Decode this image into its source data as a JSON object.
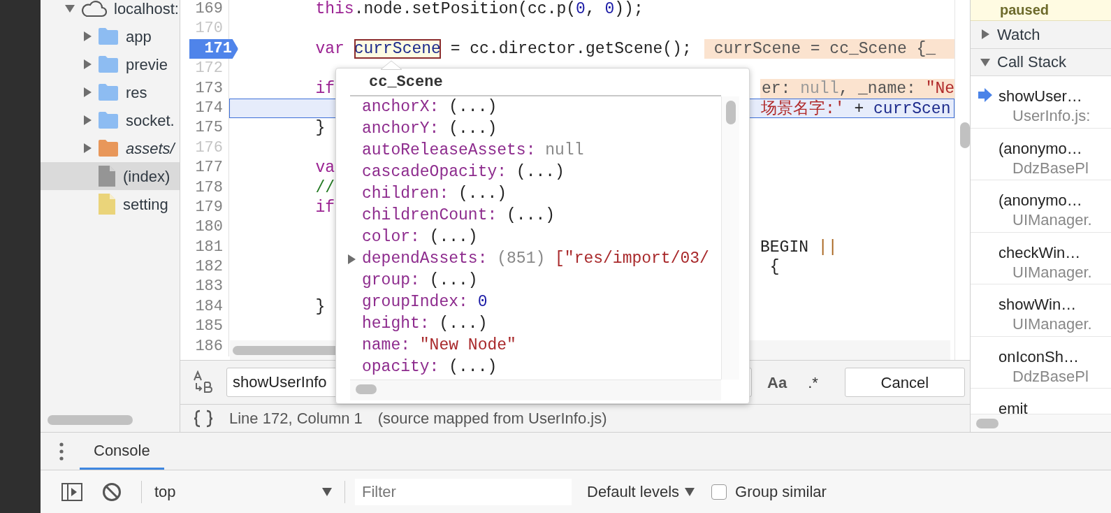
{
  "navigator": {
    "items": [
      {
        "kind": "domain",
        "label": "localhost:",
        "expanded": true,
        "selected": false,
        "children": [
          {
            "kind": "folder",
            "label": "app",
            "color": "#8dbcf2",
            "expanded": false,
            "selected": false
          },
          {
            "kind": "folder",
            "label": "previe",
            "color": "#8dbcf2",
            "expanded": false,
            "selected": false
          },
          {
            "kind": "folder",
            "label": "res",
            "color": "#8dbcf2",
            "expanded": false,
            "selected": false
          },
          {
            "kind": "folder",
            "label": "socket.",
            "color": "#8dbcf2",
            "expanded": false,
            "selected": false
          },
          {
            "kind": "authored-folder",
            "label": "assets/",
            "color": "#e8975a",
            "expanded": false,
            "selected": false
          },
          {
            "kind": "file",
            "label": "(index)",
            "color": "#959595",
            "selected": true
          },
          {
            "kind": "file",
            "label": "setting",
            "color": "#ead47a",
            "selected": false
          }
        ]
      }
    ]
  },
  "editor": {
    "lines": [
      {
        "number": "169",
        "muted": false,
        "breakpoint": false,
        "current": false,
        "left": [
          {
            "kind": "code",
            "tokens": [
              {
                "kind": "keyword",
                "text": "this"
              },
              {
                "kind": "plain",
                "text": ".node.setPosition(cc.p("
              },
              {
                "kind": "number",
                "text": "0"
              },
              {
                "kind": "plain",
                "text": ", "
              },
              {
                "kind": "number",
                "text": "0"
              },
              {
                "kind": "plain",
                "text": "));"
              }
            ]
          }
        ]
      },
      {
        "number": "170",
        "muted": true,
        "breakpoint": false,
        "current": false
      },
      {
        "number": "171",
        "muted": false,
        "breakpoint": true,
        "current": false,
        "left": [
          {
            "kind": "code",
            "tokens": [
              {
                "kind": "keyword",
                "text": "var "
              }
            ]
          },
          {
            "kind": "hover",
            "tokens": [
              {
                "kind": "variable",
                "text": "currScene"
              }
            ]
          },
          {
            "kind": "code",
            "tokens": [
              {
                "kind": "plain",
                "text": " = cc.director.getScene();"
              }
            ]
          },
          {
            "kind": "inline",
            "tokens": [
              {
                "kind": "plain",
                "text": "currScene = cc_Scene {_"
              }
            ]
          }
        ]
      },
      {
        "number": "172",
        "muted": true,
        "breakpoint": false,
        "current": false
      },
      {
        "number": "173",
        "muted": false,
        "breakpoint": false,
        "current": false,
        "left": [
          {
            "kind": "code",
            "tokens": [
              {
                "kind": "keyword",
                "text": "if"
              }
            ]
          }
        ],
        "right": [
          {
            "kind": "inline",
            "tokens": [
              {
                "kind": "plain",
                "text": "er: "
              },
              {
                "kind": "muted",
                "text": "null"
              },
              {
                "kind": "plain",
                "text": ", _name: "
              },
              {
                "kind": "string",
                "text": "\"Ne"
              }
            ]
          }
        ]
      },
      {
        "number": "174",
        "muted": false,
        "breakpoint": false,
        "current": true,
        "right": [
          {
            "kind": "code",
            "tokens": [
              {
                "kind": "string",
                "text": "场景名字:'"
              },
              {
                "kind": "plain",
                "text": " + "
              },
              {
                "kind": "variable",
                "text": "currScen"
              }
            ]
          }
        ]
      },
      {
        "number": "175",
        "muted": false,
        "breakpoint": false,
        "current": false,
        "left": [
          {
            "kind": "code",
            "tokens": [
              {
                "kind": "plain",
                "text": "}"
              }
            ]
          }
        ]
      },
      {
        "number": "176",
        "muted": true,
        "breakpoint": false,
        "current": false
      },
      {
        "number": "177",
        "muted": false,
        "breakpoint": false,
        "current": false,
        "left": [
          {
            "kind": "code",
            "tokens": [
              {
                "kind": "keyword",
                "text": "va"
              }
            ]
          }
        ]
      },
      {
        "number": "178",
        "muted": false,
        "breakpoint": false,
        "current": false,
        "left": [
          {
            "kind": "code",
            "tokens": [
              {
                "kind": "comment",
                "text": "//"
              }
            ]
          }
        ]
      },
      {
        "number": "179",
        "muted": false,
        "breakpoint": false,
        "current": false,
        "left": [
          {
            "kind": "code",
            "tokens": [
              {
                "kind": "keyword",
                "text": "if"
              }
            ]
          }
        ]
      },
      {
        "number": "180",
        "muted": false,
        "breakpoint": false,
        "current": false
      },
      {
        "number": "181",
        "muted": false,
        "breakpoint": false,
        "current": false,
        "right": [
          {
            "kind": "code",
            "tokens": [
              {
                "kind": "plain",
                "text": "BEGIN "
              },
              {
                "kind": "operator",
                "text": "||"
              }
            ]
          }
        ]
      },
      {
        "number": "182",
        "muted": false,
        "breakpoint": false,
        "current": false,
        "right": [
          {
            "kind": "code",
            "tokens": [
              {
                "kind": "plain",
                "text": " {"
              }
            ]
          }
        ]
      },
      {
        "number": "183",
        "muted": false,
        "breakpoint": false,
        "current": false
      },
      {
        "number": "184",
        "muted": false,
        "breakpoint": false,
        "current": false,
        "left": [
          {
            "kind": "code",
            "tokens": [
              {
                "kind": "plain",
                "text": "}"
              }
            ]
          }
        ]
      },
      {
        "number": "185",
        "muted": false,
        "breakpoint": false,
        "current": false
      },
      {
        "number": "186",
        "muted": false,
        "breakpoint": false,
        "current": false
      }
    ],
    "search": {
      "query": "showUserInfo",
      "match_case": "Aa",
      "regex": ".*",
      "cancel": "Cancel"
    },
    "status": {
      "position": "Line 172, Column 1",
      "source": "(source mapped from UserInfo.js)"
    }
  },
  "popover": {
    "title": "cc_Scene",
    "properties": [
      {
        "name": "anchorX:",
        "value": "(...)",
        "kind": "getter",
        "expandable": false
      },
      {
        "name": "anchorY:",
        "value": "(...)",
        "kind": "getter",
        "expandable": false
      },
      {
        "name": "autoReleaseAssets:",
        "value": "null",
        "kind": "null",
        "expandable": false
      },
      {
        "name": "cascadeOpacity:",
        "value": "(...)",
        "kind": "getter",
        "expandable": false
      },
      {
        "name": "children:",
        "value": "(...)",
        "kind": "getter",
        "expandable": false
      },
      {
        "name": "childrenCount:",
        "value": "(...)",
        "kind": "getter",
        "expandable": false
      },
      {
        "name": "color:",
        "value": "(...)",
        "kind": "getter",
        "expandable": false
      },
      {
        "name": "dependAssets:",
        "count": "(851)",
        "value": "[\"res/import/03/",
        "kind": "array",
        "expandable": true
      },
      {
        "name": "group:",
        "value": "(...)",
        "kind": "getter",
        "expandable": false
      },
      {
        "name": "groupIndex:",
        "value": "0",
        "kind": "number",
        "expandable": false
      },
      {
        "name": "height:",
        "value": "(...)",
        "kind": "getter",
        "expandable": false
      },
      {
        "name": "name:",
        "value": "\"New Node\"",
        "kind": "string",
        "expandable": false
      },
      {
        "name": "opacity:",
        "value": "(...)",
        "kind": "getter",
        "expandable": false
      }
    ]
  },
  "sidebar": {
    "status": "paused",
    "sections": [
      {
        "title": "Watch",
        "expanded": false
      },
      {
        "title": "Call Stack",
        "expanded": true
      }
    ],
    "call_stack": [
      {
        "function": "showUser…",
        "location": "UserInfo.js:",
        "selected": true
      },
      {
        "function": "(anonymo…",
        "location": "DdzBasePl",
        "selected": false
      },
      {
        "function": "(anonymo…",
        "location": "UIManager.",
        "selected": false
      },
      {
        "function": "checkWin…",
        "location": "UIManager.",
        "selected": false
      },
      {
        "function": "showWin…",
        "location": "UIManager.",
        "selected": false
      },
      {
        "function": "onIconSh…",
        "location": "DdzBasePl",
        "selected": false
      },
      {
        "function": "emit",
        "selected": false
      }
    ]
  },
  "drawer": {
    "tabs": [
      {
        "label": "Console",
        "selected": true
      }
    ],
    "context": "top",
    "filter_placeholder": "Filter",
    "levels": "Default levels",
    "group_similar": {
      "label": "Group similar",
      "checked": false
    }
  }
}
